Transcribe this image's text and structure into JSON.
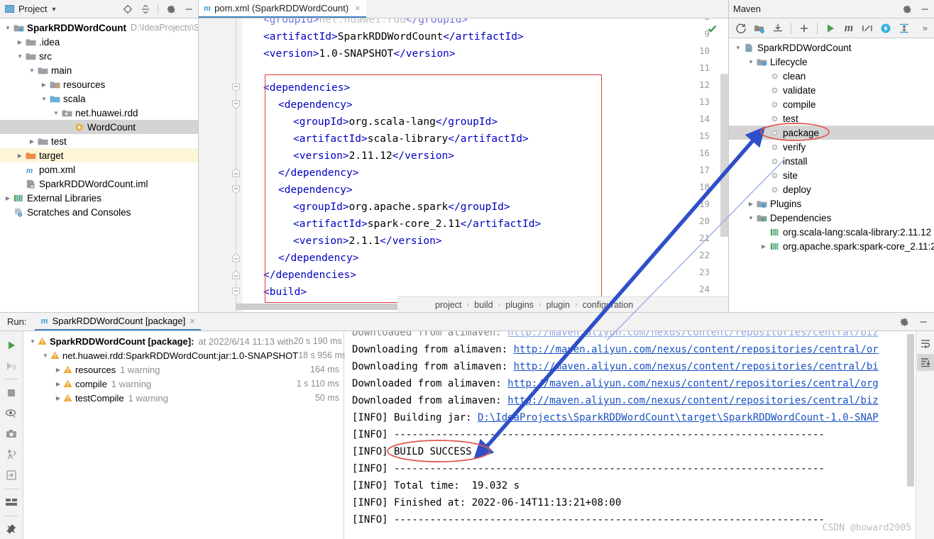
{
  "project_panel": {
    "title": "Project",
    "icons": [
      "locate-icon",
      "collapse-all-icon",
      "gear-icon",
      "minimize-icon"
    ],
    "tree": [
      {
        "label": "SparkRDDWordCount",
        "path": "D:\\IdeaProjects\\S",
        "indent": 0,
        "arrow": "down",
        "icon": "module-folder-icon",
        "bold": true,
        "state": "normal"
      },
      {
        "label": ".idea",
        "path": "",
        "indent": 1,
        "arrow": "right",
        "icon": "folder-icon",
        "bold": false,
        "state": "normal"
      },
      {
        "label": "src",
        "path": "",
        "indent": 1,
        "arrow": "down",
        "icon": "folder-icon",
        "bold": false,
        "state": "normal"
      },
      {
        "label": "main",
        "path": "",
        "indent": 2,
        "arrow": "down",
        "icon": "folder-icon",
        "bold": false,
        "state": "normal"
      },
      {
        "label": "resources",
        "path": "",
        "indent": 3,
        "arrow": "right",
        "icon": "resources-folder-icon",
        "bold": false,
        "state": "normal"
      },
      {
        "label": "scala",
        "path": "",
        "indent": 3,
        "arrow": "down",
        "icon": "source-folder-icon",
        "bold": false,
        "state": "normal"
      },
      {
        "label": "net.huawei.rdd",
        "path": "",
        "indent": 4,
        "arrow": "down",
        "icon": "package-icon",
        "bold": false,
        "state": "normal"
      },
      {
        "label": "WordCount",
        "path": "",
        "indent": 5,
        "arrow": "none",
        "icon": "scala-object-icon",
        "bold": false,
        "state": "selected"
      },
      {
        "label": "test",
        "path": "",
        "indent": 2,
        "arrow": "right",
        "icon": "folder-icon",
        "bold": false,
        "state": "normal"
      },
      {
        "label": "target",
        "path": "",
        "indent": 1,
        "arrow": "right",
        "icon": "target-folder-icon",
        "bold": false,
        "state": "highlighted"
      },
      {
        "label": "pom.xml",
        "path": "",
        "indent": 1,
        "arrow": "none",
        "icon": "maven-file-icon",
        "bold": false,
        "state": "normal"
      },
      {
        "label": "SparkRDDWordCount.iml",
        "path": "",
        "indent": 1,
        "arrow": "none",
        "icon": "iml-file-icon",
        "bold": false,
        "state": "normal"
      },
      {
        "label": "External Libraries",
        "path": "",
        "indent": 0,
        "arrow": "right",
        "icon": "libraries-icon",
        "bold": false,
        "state": "normal"
      },
      {
        "label": "Scratches and Consoles",
        "path": "",
        "indent": 0,
        "arrow": "none",
        "icon": "scratches-icon",
        "bold": false,
        "state": "normal"
      }
    ]
  },
  "editor": {
    "tab": {
      "label": "pom.xml (SparkRDDWordCount)",
      "icon": "maven-file-icon",
      "close": "×"
    },
    "first_line_number": 9,
    "lines": [
      {
        "num": 8,
        "indent": 2,
        "text": "<groupId>net.huawei.rdd</groupId>",
        "clipped_top": true
      },
      {
        "num": 9,
        "indent": 2,
        "text": "<artifactId>SparkRDDWordCount</artifactId>"
      },
      {
        "num": 10,
        "indent": 2,
        "text": "<version>1.0-SNAPSHOT</version>"
      },
      {
        "num": 11,
        "indent": 0,
        "text": ""
      },
      {
        "num": 12,
        "indent": 2,
        "text": "<dependencies>",
        "fold": "collapse"
      },
      {
        "num": 13,
        "indent": 4,
        "text": "<dependency>",
        "fold": "collapse"
      },
      {
        "num": 14,
        "indent": 6,
        "text": "<groupId>org.scala-lang</groupId>"
      },
      {
        "num": 15,
        "indent": 6,
        "text": "<artifactId>scala-library</artifactId>"
      },
      {
        "num": 16,
        "indent": 6,
        "text": "<version>2.11.12</version>"
      },
      {
        "num": 17,
        "indent": 4,
        "text": "</dependency>",
        "fold": "end"
      },
      {
        "num": 18,
        "indent": 4,
        "text": "<dependency>",
        "fold": "collapse"
      },
      {
        "num": 19,
        "indent": 6,
        "text": "<groupId>org.apache.spark</groupId>"
      },
      {
        "num": 20,
        "indent": 6,
        "text": "<artifactId>spark-core_2.11</artifactId>"
      },
      {
        "num": 21,
        "indent": 6,
        "text": "<version>2.1.1</version>"
      },
      {
        "num": 22,
        "indent": 4,
        "text": "</dependency>",
        "fold": "end"
      },
      {
        "num": 23,
        "indent": 2,
        "text": "</dependencies>",
        "fold": "end"
      },
      {
        "num": 24,
        "indent": 2,
        "text": "<build>",
        "fold": "collapse"
      }
    ],
    "breadcrumbs": [
      "project",
      "build",
      "plugins",
      "plugin",
      "configuration"
    ],
    "inspection_status": "ok-check-icon"
  },
  "maven_panel": {
    "title": "Maven",
    "header_icons": [
      "gear-icon",
      "minimize-icon"
    ],
    "toolbar_icons": [
      "reload-icon",
      "add-managed-project-icon",
      "download-sources-icon",
      "plus-icon",
      "run-icon",
      "maven-goal-icon",
      "toggle-skip-tests-icon",
      "toggle-offline-icon",
      "expand-collapse-icon",
      "more-icon"
    ],
    "tree": [
      {
        "label": "SparkRDDWordCount",
        "indent": 0,
        "arrow": "down",
        "icon": "maven-project-icon",
        "state": "normal"
      },
      {
        "label": "Lifecycle",
        "indent": 1,
        "arrow": "down",
        "icon": "lifecycle-folder-icon",
        "state": "normal"
      },
      {
        "label": "clean",
        "indent": 2,
        "arrow": "none",
        "icon": "gear-icon",
        "state": "normal"
      },
      {
        "label": "validate",
        "indent": 2,
        "arrow": "none",
        "icon": "gear-icon",
        "state": "normal"
      },
      {
        "label": "compile",
        "indent": 2,
        "arrow": "none",
        "icon": "gear-icon",
        "state": "normal"
      },
      {
        "label": "test",
        "indent": 2,
        "arrow": "none",
        "icon": "gear-icon",
        "state": "normal"
      },
      {
        "label": "package",
        "indent": 2,
        "arrow": "none",
        "icon": "gear-icon",
        "state": "selected"
      },
      {
        "label": "verify",
        "indent": 2,
        "arrow": "none",
        "icon": "gear-icon",
        "state": "normal"
      },
      {
        "label": "install",
        "indent": 2,
        "arrow": "none",
        "icon": "gear-icon",
        "state": "normal"
      },
      {
        "label": "site",
        "indent": 2,
        "arrow": "none",
        "icon": "gear-icon",
        "state": "normal"
      },
      {
        "label": "deploy",
        "indent": 2,
        "arrow": "none",
        "icon": "gear-icon",
        "state": "normal"
      },
      {
        "label": "Plugins",
        "indent": 1,
        "arrow": "right",
        "icon": "plugins-folder-icon",
        "state": "normal"
      },
      {
        "label": "Dependencies",
        "indent": 1,
        "arrow": "down",
        "icon": "dependencies-folder-icon",
        "state": "normal"
      },
      {
        "label": "org.scala-lang:scala-library:2.11.12",
        "indent": 2,
        "arrow": "none",
        "icon": "library-icon",
        "state": "normal"
      },
      {
        "label": "org.apache.spark:spark-core_2.11:2.",
        "indent": 2,
        "arrow": "right",
        "icon": "library-icon",
        "state": "normal"
      }
    ]
  },
  "run_panel": {
    "label": "Run:",
    "tab": {
      "label": "SparkRDDWordCount [package]",
      "icon": "maven-file-icon",
      "close": "×"
    },
    "header_icons": [
      "gear-icon",
      "minimize-icon"
    ],
    "side_icons": [
      "rerun-icon",
      "rerun-failed-icon",
      "stop-icon",
      "toggle-soft-wrap-icon",
      "screenshot-icon",
      "show-passed-icon",
      "export-icon",
      "layout-icon",
      "pin-icon"
    ],
    "tree": [
      {
        "name": "SparkRDDWordCount [package]:",
        "meta": "at 2022/6/14 11:13 with",
        "time": "20 s 190 ms",
        "indent": 0,
        "arrow": "down",
        "bold": true
      },
      {
        "name": "net.huawei.rdd:SparkRDDWordCount:jar:1.0-SNAPSHOT",
        "meta": "",
        "time": "18 s 956 ms",
        "indent": 1,
        "arrow": "down",
        "bold": false
      },
      {
        "name": "resources",
        "meta": "1 warning",
        "time": "164 ms",
        "indent": 2,
        "arrow": "right",
        "bold": false
      },
      {
        "name": "compile",
        "meta": "1 warning",
        "time": "1 s 110 ms",
        "indent": 2,
        "arrow": "right",
        "bold": false
      },
      {
        "name": "testCompile",
        "meta": "1 warning",
        "time": "50 ms",
        "indent": 2,
        "arrow": "right",
        "bold": false
      }
    ],
    "console_lines": [
      {
        "prefix": "Downloaded from alimaven: ",
        "link": "http://maven.aliyun.com/nexus/content/repositories/central/biz",
        "clipped_top": true
      },
      {
        "prefix": "Downloading from alimaven: ",
        "link": "http://maven.aliyun.com/nexus/content/repositories/central/or"
      },
      {
        "prefix": "Downloading from alimaven: ",
        "link": "http://maven.aliyun.com/nexus/content/repositories/central/bi"
      },
      {
        "prefix": "Downloaded from alimaven: ",
        "link": "http://maven.aliyun.com/nexus/content/repositories/central/org"
      },
      {
        "prefix": "Downloaded from alimaven: ",
        "link": "http://maven.aliyun.com/nexus/content/repositories/central/biz"
      },
      {
        "prefix": "[INFO] Building jar: ",
        "link": "D:\\IdeaProjects\\SparkRDDWordCount\\target\\SparkRDDWordCount-1.0-SNAP"
      },
      {
        "prefix": "[INFO] ------------------------------------------------------------------------",
        "link": ""
      },
      {
        "prefix": "[INFO] BUILD SUCCESS",
        "link": ""
      },
      {
        "prefix": "[INFO] ------------------------------------------------------------------------",
        "link": ""
      },
      {
        "prefix": "[INFO] Total time:  19.032 s",
        "link": ""
      },
      {
        "prefix": "[INFO] Finished at: 2022-06-14T11:13:21+08:00",
        "link": ""
      },
      {
        "prefix": "[INFO] ------------------------------------------------------------------------",
        "link": ""
      }
    ],
    "console_side_icons": [
      "soft-wrap-icon",
      "scroll-to-end-icon"
    ],
    "watermark": "CSDN @howard2005"
  },
  "annotations": {
    "ellipse_package": "red-ellipse-package",
    "ellipse_build_success": "red-ellipse-build-success",
    "arrow_main": "blue-arrow-pointing-to-package",
    "arrow_secondary": "faint-blue-arrow",
    "red_box_dependencies": "red-rectangle-around-dependencies"
  },
  "colors": {
    "accent_blue": "#2f4fc8",
    "annotation_red": "#e03b34",
    "link_blue": "#1a52c4",
    "selection_gray": "#d4d4d4",
    "tag_blue": "#0000c0"
  }
}
